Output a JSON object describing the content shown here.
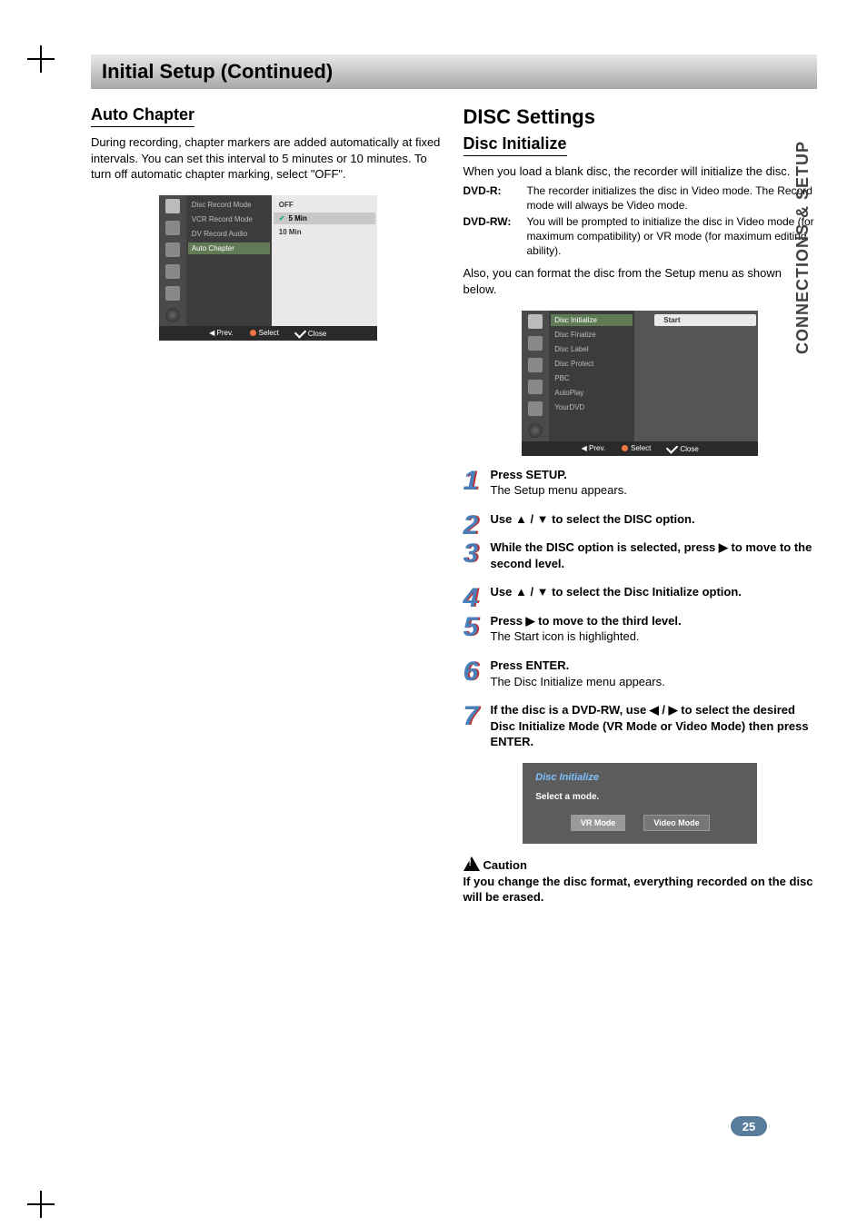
{
  "section_title": "Initial Setup (Continued)",
  "side_tab": "CONNECTIONS & SETUP",
  "page_number": "25",
  "left": {
    "heading": "Auto Chapter",
    "body": "During recording, chapter markers are added automatically at fixed intervals. You can set this interval to 5 minutes or 10 minutes. To turn off automatic chapter marking, select \"OFF\"."
  },
  "osd1": {
    "labels": [
      "Disc Record Mode",
      "VCR Record Mode",
      "DV Record Audio",
      "Auto Chapter"
    ],
    "selected_label": "Auto Chapter",
    "values": [
      "OFF",
      "5 Min",
      "10 Min"
    ],
    "selected_value": "5 Min",
    "footer": {
      "prev": "Prev.",
      "select": "Select",
      "close": "Close"
    }
  },
  "right": {
    "heading_big": "DISC Settings",
    "heading_sub": "Disc Initialize",
    "intro": "When you load a blank disc, the recorder will initialize the disc.",
    "defs": [
      {
        "k": "DVD-R:",
        "v": "The recorder initializes the disc in Video mode. The Record mode will always be Video mode."
      },
      {
        "k": "DVD-RW:",
        "v": "You will be prompted to initialize the disc in Video mode (for maximum compatibility) or VR mode (for maximum editing ability)."
      }
    ],
    "after_defs": "Also, you can format the disc from the Setup menu as shown below."
  },
  "osd2": {
    "labels": [
      "Disc Initialize",
      "Disc Finalize",
      "Disc Label",
      "Disc Protect",
      "PBC",
      "AutoPlay",
      "YourDVD"
    ],
    "selected_label": "Disc Initialize",
    "start_button": "Start",
    "footer": {
      "prev": "Prev.",
      "select": "Select",
      "close": "Close"
    }
  },
  "steps": [
    {
      "bold": "Press SETUP.",
      "rest": "The Setup menu appears."
    },
    {
      "bold": "Use ▲ / ▼ to select the DISC option.",
      "rest": ""
    },
    {
      "bold": "While the DISC option is selected, press ▶ to move to the second level.",
      "rest": ""
    },
    {
      "bold": "Use ▲ / ▼ to select the Disc Initialize option.",
      "rest": ""
    },
    {
      "bold": "Press ▶ to move to the third level.",
      "rest": "The Start icon is highlighted."
    },
    {
      "bold": "Press ENTER.",
      "rest": "The Disc Initialize menu appears."
    },
    {
      "bold": "If the disc is a DVD-RW, use ◀ / ▶ to select the desired Disc Initialize Mode (VR Mode or Video Mode) then press ENTER.",
      "rest": ""
    }
  ],
  "dialog": {
    "title": "Disc Initialize",
    "message": "Select a mode.",
    "buttons": [
      "VR Mode",
      "Video Mode"
    ]
  },
  "caution": {
    "label": "Caution",
    "text": "If you change the disc format, everything recorded on the disc will be erased."
  }
}
